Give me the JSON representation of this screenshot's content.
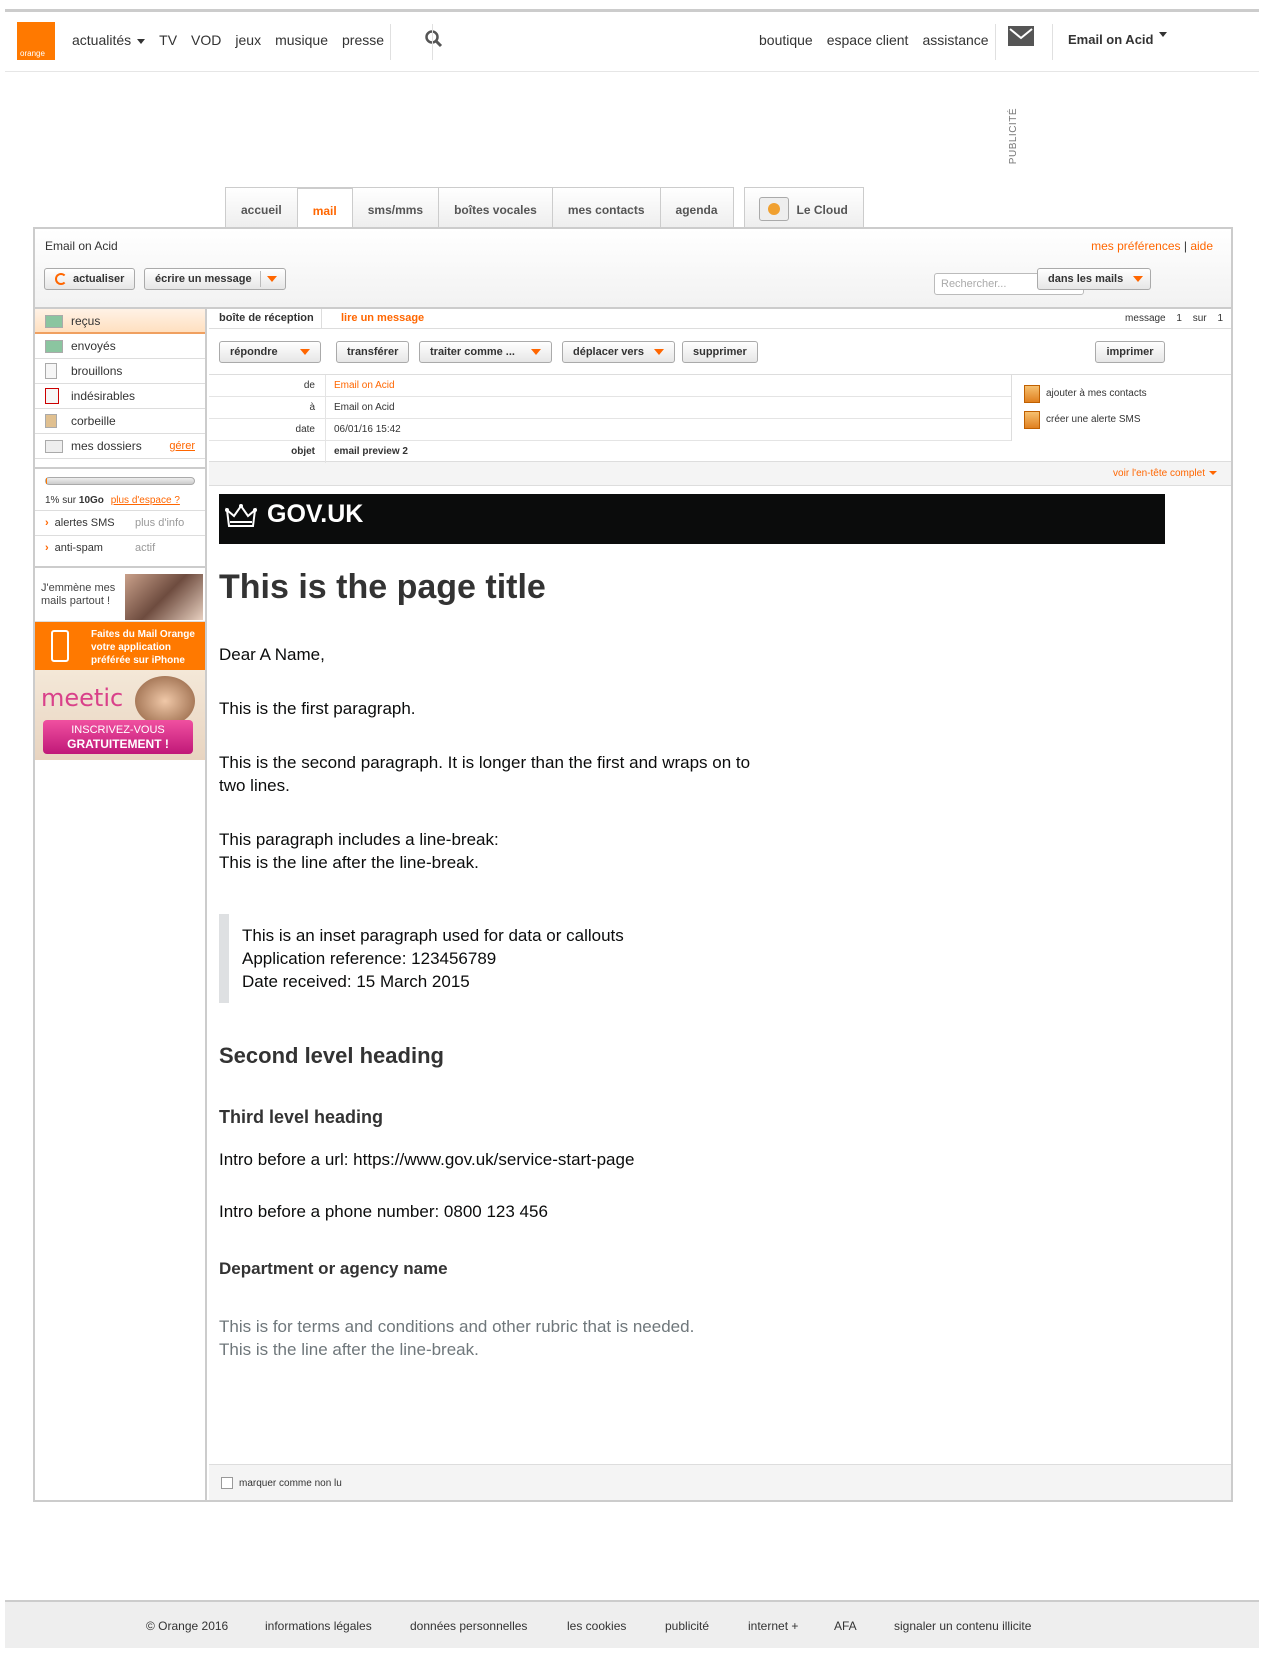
{
  "brand": {
    "logo_text": "orange",
    "color": "#ff7900"
  },
  "topnav": {
    "left": [
      "actualités",
      "TV",
      "VOD",
      "jeux",
      "musique",
      "presse"
    ],
    "right": [
      "boutique",
      "espace client",
      "assistance"
    ],
    "user": "Email on Acid"
  },
  "ad_label": "PUBLICITÉ",
  "tabs": [
    "accueil",
    "mail",
    "sms/mms",
    "boîtes vocales",
    "mes contacts",
    "agenda",
    "Le Cloud"
  ],
  "header": {
    "account": "Email on Acid",
    "preferences": "mes préférences",
    "separator": "|",
    "help": "aide",
    "refresh_label": "actualiser",
    "compose_label": "écrire un message",
    "search_placeholder": "Rechercher...",
    "search_scope": "dans les mails"
  },
  "folders": [
    {
      "label": "reçus",
      "icon": "inbox-icon"
    },
    {
      "label": "envoyés",
      "icon": "sent-icon"
    },
    {
      "label": "brouillons",
      "icon": "draft-icon"
    },
    {
      "label": "indésirables",
      "icon": "spam-icon"
    },
    {
      "label": "corbeille",
      "icon": "trash-icon"
    },
    {
      "label": "mes dossiers",
      "icon": "folder-icon",
      "action": "gérer"
    }
  ],
  "quota": {
    "used": "1% sur",
    "total": "10Go",
    "more": "plus d'espace ?",
    "fraction": 0.01
  },
  "side_links": [
    {
      "label": "alertes SMS",
      "aux": "plus d'info"
    },
    {
      "label": "anti-spam",
      "aux": "actif"
    }
  ],
  "ads": {
    "ad1_text": "J'emmène mes mails partout !",
    "ad2_text": "Faites du Mail Orange votre application préférée sur iPhone",
    "ad3_brand": "meetic",
    "ad3_cta1": "INSCRIVEZ-VOUS",
    "ad3_cta2": "GRATUITEMENT !"
  },
  "breadcrumb": {
    "inbox": "boîte de réception",
    "current": "lire un message"
  },
  "message_counter": {
    "label": "message",
    "index": "1",
    "of": "sur",
    "total": "1"
  },
  "actions": {
    "reply": "répondre",
    "forward": "transférer",
    "process": "traiter comme ...",
    "move": "déplacer vers",
    "delete": "supprimer",
    "print": "imprimer"
  },
  "meta": {
    "from_label": "de",
    "from": "Email on Acid",
    "to_label": "à",
    "to": "Email on Acid",
    "date_label": "date",
    "date": "06/01/16 15:42",
    "subject_label": "objet",
    "subject": "email preview 2",
    "add_contact": "ajouter à mes contacts",
    "sms_alert": "créer une alerte SMS",
    "full_header": "voir l'en-tête complet"
  },
  "email": {
    "banner": "GOV.UK",
    "title": "This is the page title",
    "greeting": "Dear A Name,",
    "p1": "This is the first paragraph.",
    "p2": "This is the second paragraph. It is longer than the first and wraps on to two lines.",
    "p3a": "This paragraph includes a line-break:",
    "p3b": "This is the line after the line-break.",
    "inset1": "This is an inset paragraph used for data or callouts",
    "inset2": "Application reference: 123456789",
    "inset3": "Date received: 15 March 2015",
    "h2": "Second level heading",
    "h3": "Third level heading",
    "url_line": "Intro before a url: https://www.gov.uk/service-start-page",
    "phone_line": "Intro before a phone number: 0800 123 456",
    "dept": "Department or agency name",
    "rubric1": "This is for terms and conditions and other rubric that is needed.",
    "rubric2": "This is the line after the line-break."
  },
  "mark_unread": "marquer comme non lu",
  "footer": [
    "© Orange 2016",
    "informations légales",
    "données personnelles",
    "les cookies",
    "publicité",
    "internet +",
    "AFA",
    "signaler un contenu illicite"
  ]
}
